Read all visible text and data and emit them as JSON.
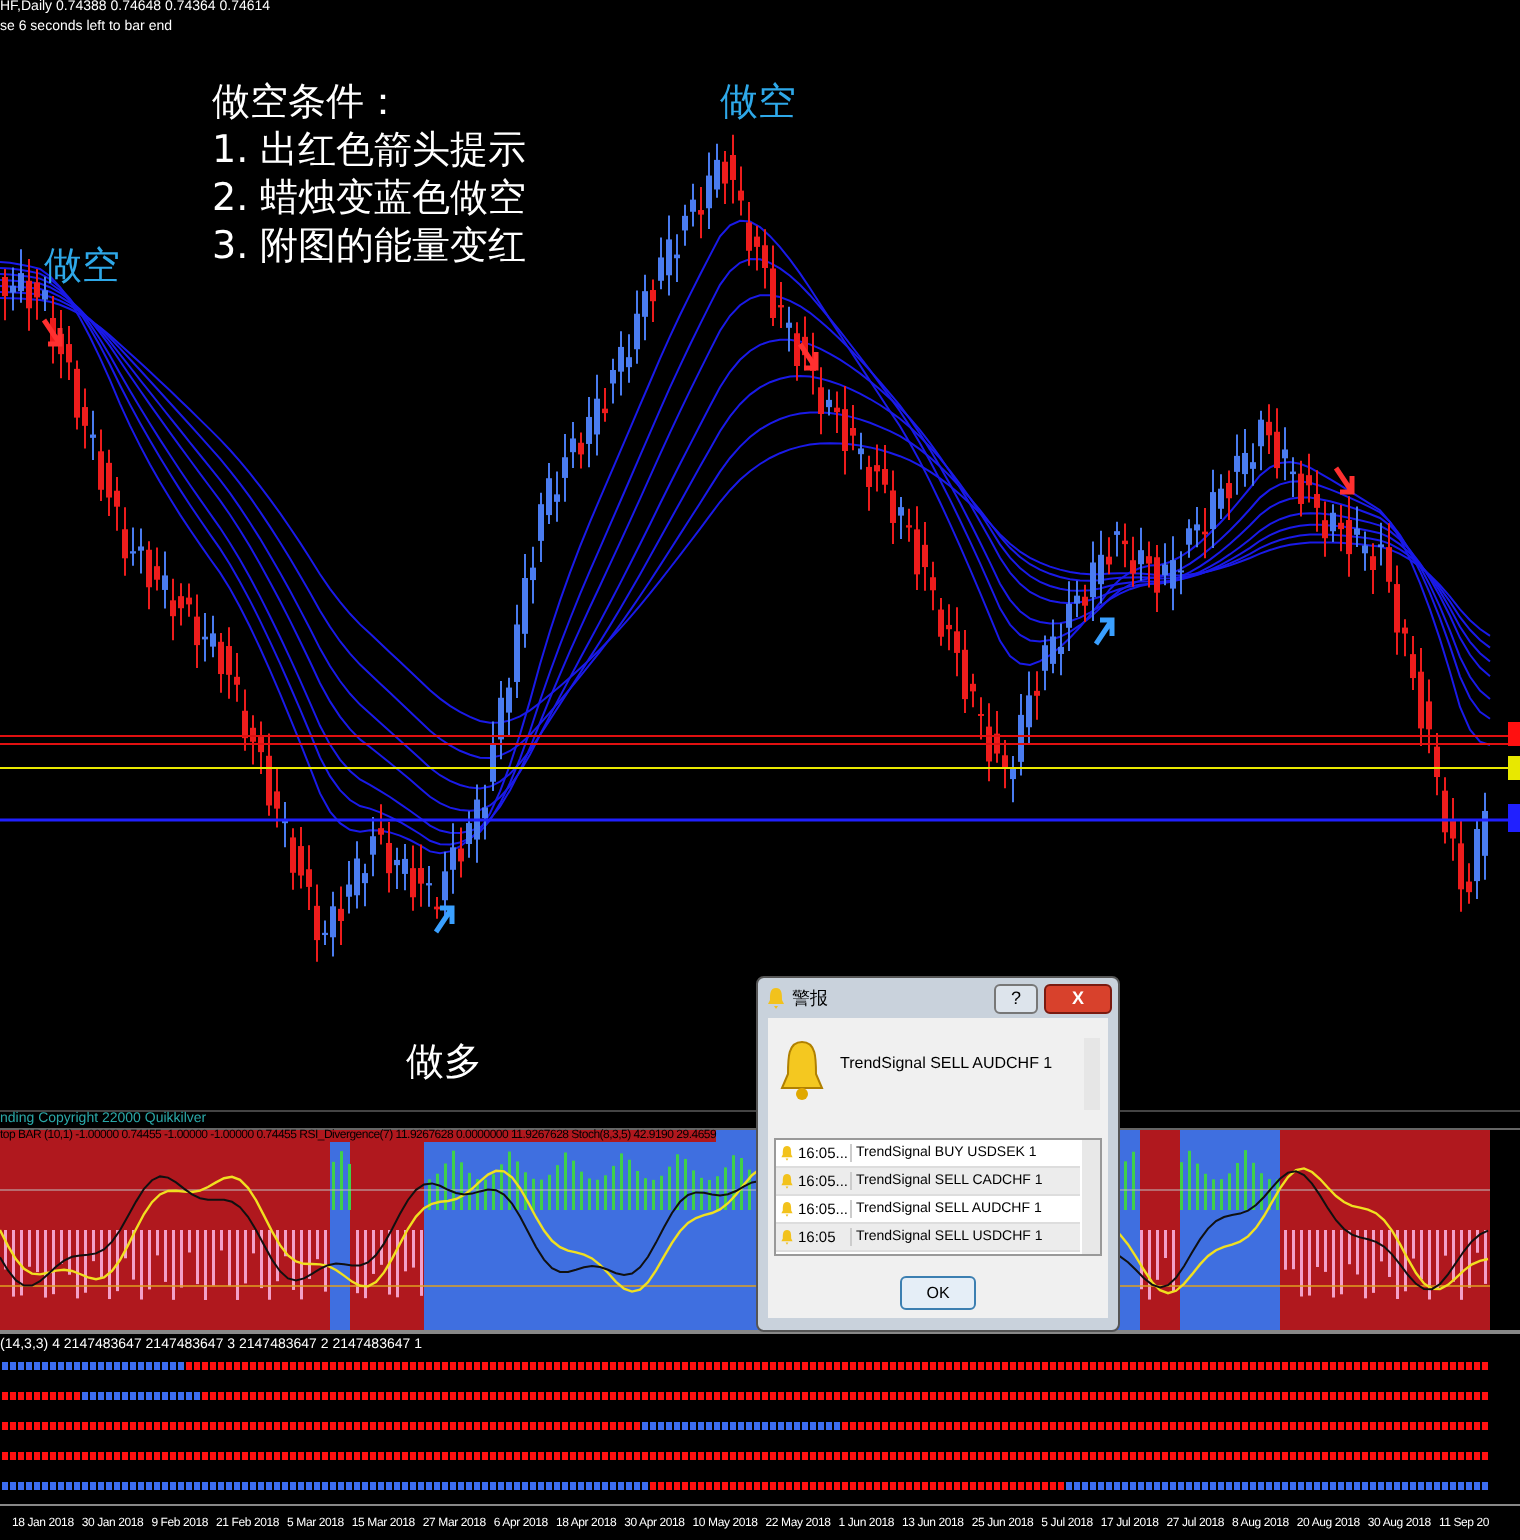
{
  "chart": {
    "title": "HF,Daily  0.74388 0.74648 0.74364 0.74614",
    "countdown": "se 6 seconds left to bar end"
  },
  "annotations": [
    {
      "kind": "note",
      "text": "做空条件："
    },
    {
      "kind": "note",
      "text": "1. 出红色箭头提示"
    },
    {
      "kind": "note",
      "text": "2. 蜡烛变蓝色做空"
    },
    {
      "kind": "note",
      "text": "3. 附图的能量变红"
    },
    {
      "kind": "short",
      "text": "做空"
    },
    {
      "kind": "short",
      "text": "做空"
    },
    {
      "kind": "long",
      "text": "做多"
    }
  ],
  "indicator_1": {
    "copyright": "nding  Copyright 22000  Quikkilver",
    "label": "top BAR (10,1) -1.00000 0.74455 -1.00000 -1.00000 0.74455  RSI_Divergence(7) 11.9267628 0.0000000 11.9267628  Stoch(8,3,5) 42.9190 29.4659"
  },
  "indicator_2": {
    "label": "(14,3,3) 4 2147483647 2147483647 3 2147483647 2 2147483647 1"
  },
  "x_axis": [
    "18 Jan 2018",
    "30 Jan 2018",
    "9 Feb 2018",
    "21 Feb 2018",
    "5 Mar 2018",
    "15 Mar 2018",
    "27 Mar 2018",
    "6 Apr 2018",
    "18 Apr 2018",
    "30 Apr 2018",
    "10 May 2018",
    "22 May 2018",
    "1 Jun 2018",
    "13 Jun 2018",
    "25 Jun 2018",
    "5 Jul 2018",
    "17 Jul 2018",
    "27 Jul 2018",
    "8 Aug 2018",
    "20 Aug 2018",
    "30 Aug 2018",
    "11 Sep 20"
  ],
  "alert_dialog": {
    "title": "警报",
    "help": "?",
    "close": "X",
    "message": "TrendSignal SELL  AUDCHF  1",
    "rows": [
      {
        "time": "16:05...",
        "text": "TrendSignal BUY  USDSEK  1"
      },
      {
        "time": "16:05...",
        "text": "TrendSignal SELL  CADCHF  1"
      },
      {
        "time": "16:05...",
        "text": "TrendSignal SELL  AUDCHF  1"
      },
      {
        "time": "16:05",
        "text": "TrendSignal SELL  USDCHF  1"
      }
    ],
    "ok": "OK"
  }
}
